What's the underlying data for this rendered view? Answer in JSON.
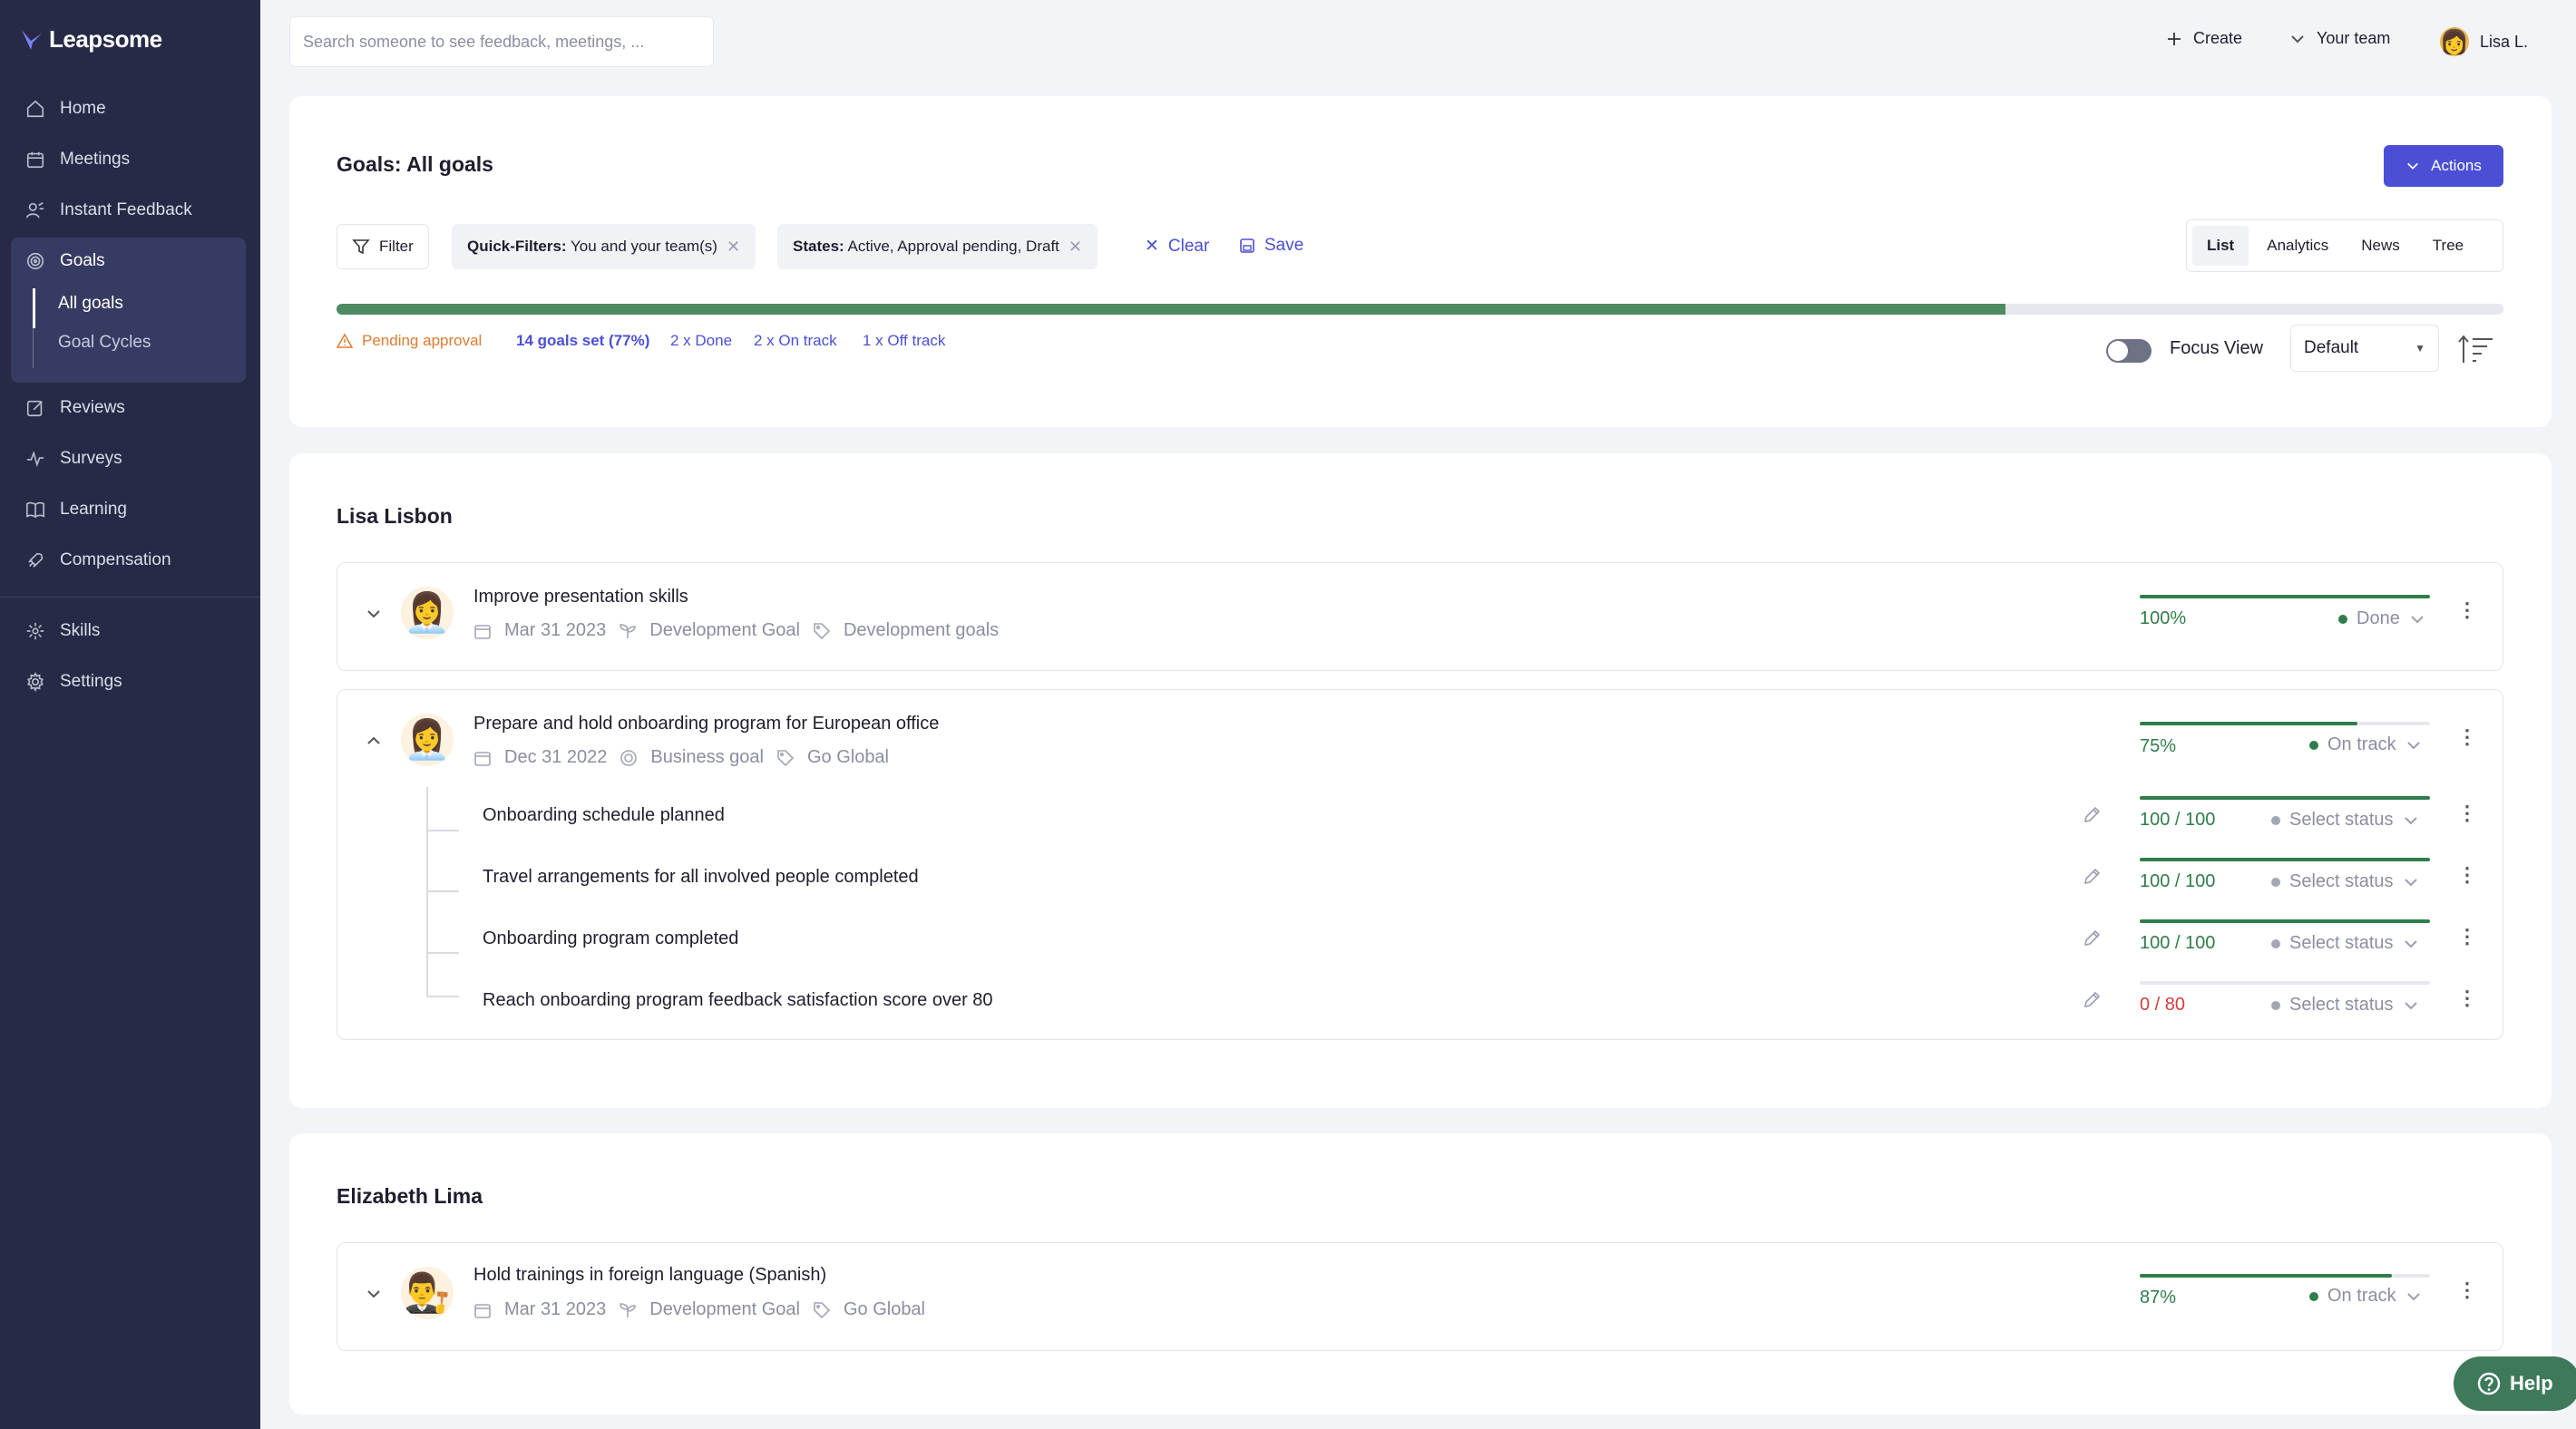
{
  "app": {
    "brand": "Leapsome"
  },
  "sidebar": {
    "items": [
      {
        "label": "Home",
        "icon": "home-icon"
      },
      {
        "label": "Meetings",
        "icon": "calendar-icon"
      },
      {
        "label": "Instant Feedback",
        "icon": "feedback-icon"
      },
      {
        "label": "Goals",
        "icon": "target-icon"
      },
      {
        "label": "Reviews",
        "icon": "edit-icon"
      },
      {
        "label": "Surveys",
        "icon": "pulse-icon"
      },
      {
        "label": "Learning",
        "icon": "book-icon"
      },
      {
        "label": "Compensation",
        "icon": "rocket-icon"
      },
      {
        "label": "Skills",
        "icon": "skills-icon"
      },
      {
        "label": "Settings",
        "icon": "gear-icon"
      }
    ],
    "goals_sub": [
      {
        "label": "All goals"
      },
      {
        "label": "Goal Cycles"
      }
    ]
  },
  "topbar": {
    "search_placeholder": "Search someone to see feedback, meetings, ...",
    "create": "Create",
    "your_team": "Your team",
    "user": "Lisa L."
  },
  "header": {
    "title": "Goals: All goals",
    "actions": "Actions",
    "filter": "Filter",
    "quick_filters_key": "Quick-Filters:",
    "quick_filters_value": "You and your team(s)",
    "states_key": "States:",
    "states_value": "Active, Approval pending, Draft",
    "clear": "Clear",
    "save": "Save",
    "view_tabs": [
      "List",
      "Analytics",
      "News",
      "Tree"
    ],
    "progress": 0.77,
    "stats": {
      "pending": "Pending approval",
      "set": "14 goals set (77%)",
      "done": "2 x Done",
      "on_track": "2 x On track",
      "off_track": "1 x Off track"
    },
    "focus_view": "Focus View",
    "sort": "Default"
  },
  "colors": {
    "accent": "#4a4fd6",
    "sidebar": "#262a46",
    "success": "#2f7d4a",
    "warning": "#e07b2f",
    "danger": "#d93c3c"
  },
  "groups": [
    {
      "owner": "Lisa Lisbon",
      "goals": [
        {
          "title": "Improve presentation skills",
          "date": "Mar 31 2023",
          "type": "Development Goal",
          "tag": "Development goals",
          "progress": 1.0,
          "pct": "100%",
          "status": "Done",
          "emoji": "👩‍💼"
        },
        {
          "title": "Prepare and hold onboarding program for European office",
          "date": "Dec 31 2022",
          "type": "Business goal",
          "tag": "Go Global",
          "progress": 0.75,
          "pct": "75%",
          "status": "On track",
          "emoji": "👩‍💼",
          "key_results": [
            {
              "title": "Onboarding schedule planned",
              "value": "100 / 100",
              "progress": 1.0,
              "status": "Select status"
            },
            {
              "title": "Travel arrangements for all involved people completed",
              "value": "100 / 100",
              "progress": 1.0,
              "status": "Select status"
            },
            {
              "title": "Onboarding program completed",
              "value": "100 / 100",
              "progress": 1.0,
              "status": "Select status"
            },
            {
              "title": "Reach onboarding program feedback satisfaction score over 80",
              "value": "0 / 80",
              "progress": 0.0,
              "status": "Select status"
            }
          ]
        }
      ]
    },
    {
      "owner": "Elizabeth Lima",
      "goals": [
        {
          "title": "Hold trainings in foreign language (Spanish)",
          "date": "Mar 31 2023",
          "type": "Development Goal",
          "tag": "Go Global",
          "progress": 0.87,
          "pct": "87%",
          "status": "On track",
          "emoji": "👨‍⚖️"
        }
      ]
    }
  ],
  "help": "Help"
}
